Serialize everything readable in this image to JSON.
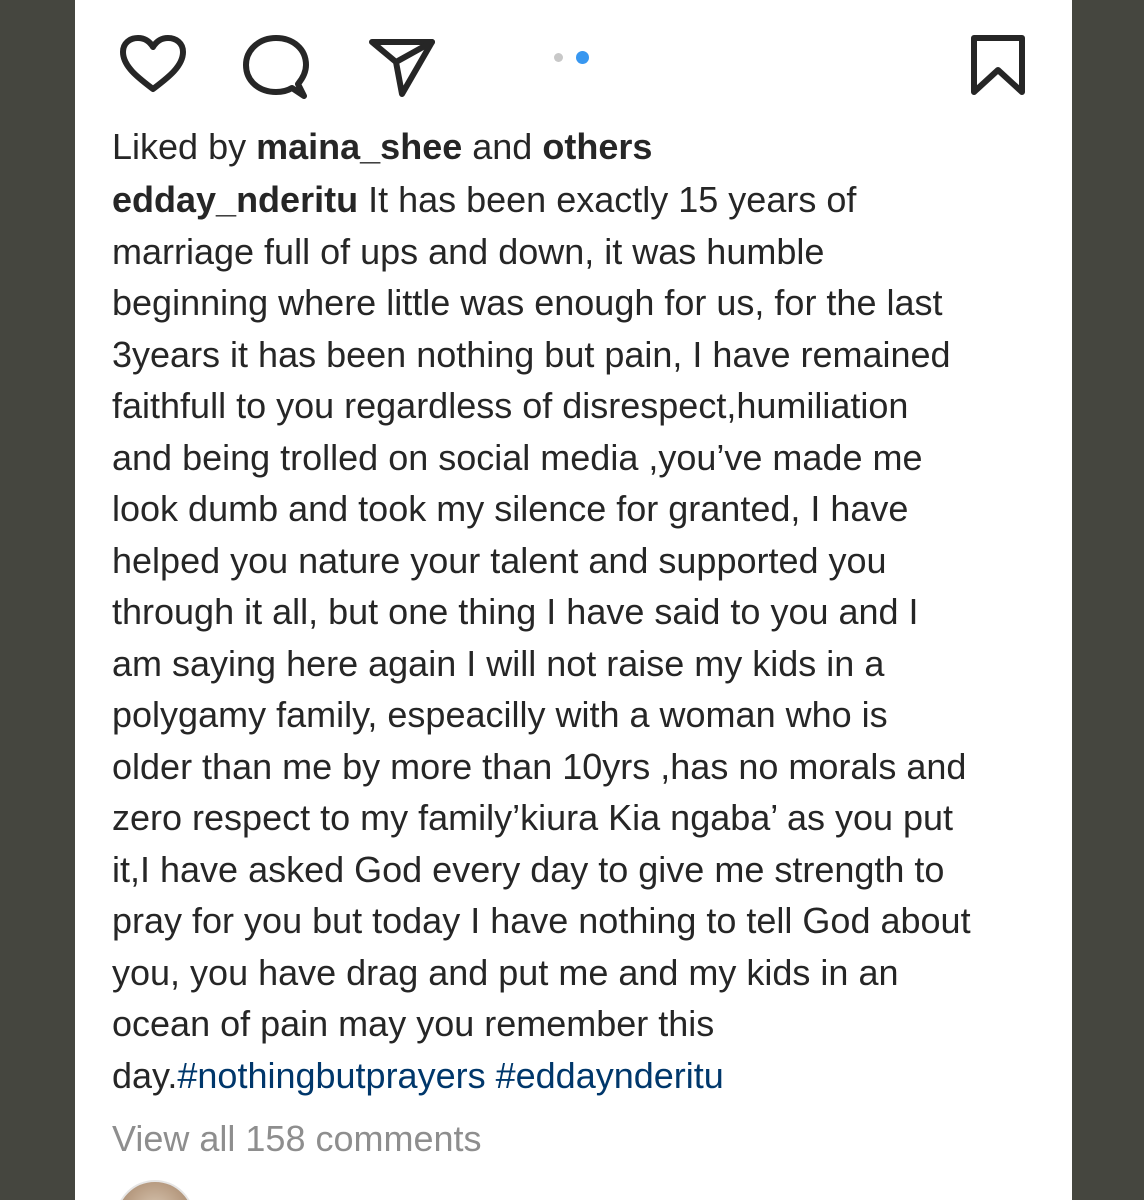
{
  "icons": {
    "like": "heart-outline",
    "comment": "speech-bubble-outline",
    "share": "paper-plane-outline",
    "save": "bookmark-outline"
  },
  "carousel": {
    "total": 2,
    "active": 2,
    "active_color": "#3897f0",
    "inactive_color": "#c8c8c8"
  },
  "likes": {
    "prefix": "Liked by",
    "user": "maina_shee",
    "conjunction": "and",
    "others": "others"
  },
  "caption": {
    "username": "edday_nderitu",
    "lines": [
      " It has been exactly 15 years of",
      "marriage full of ups and down, it was humble",
      "beginning where little was enough for us, for the last",
      "3years it has been nothing but pain, I have remained",
      "faithfull to you regardless of disrespect,humiliation",
      "and being trolled on social media ,you’ve made me",
      "look dumb and took my silence for granted, I have",
      "helped you nature your talent and supported you",
      "through it all, but one thing I have said to you and I",
      "am saying here again I will not raise my kids in a",
      "polygamy family, espeacilly with a woman who is",
      "older than me by more than 10yrs ,has no morals and",
      "zero respect to my family’kiura Kia ngaba’  as you put",
      "it,I have asked God every day to give me strength to",
      "pray for you but today I have nothing to tell God about",
      "you, you have drag and put me and my kids in an",
      "ocean of pain may you remember this"
    ],
    "last_line_text": "day.",
    "hashtags": [
      "#nothingbutprayers",
      "#eddaynderitu"
    ]
  },
  "comments": {
    "view_all": "View all 158 comments"
  },
  "colors": {
    "text": "#262626",
    "muted": "#8e8e8e",
    "hashtag": "#00376b",
    "frame": "#45463f"
  }
}
